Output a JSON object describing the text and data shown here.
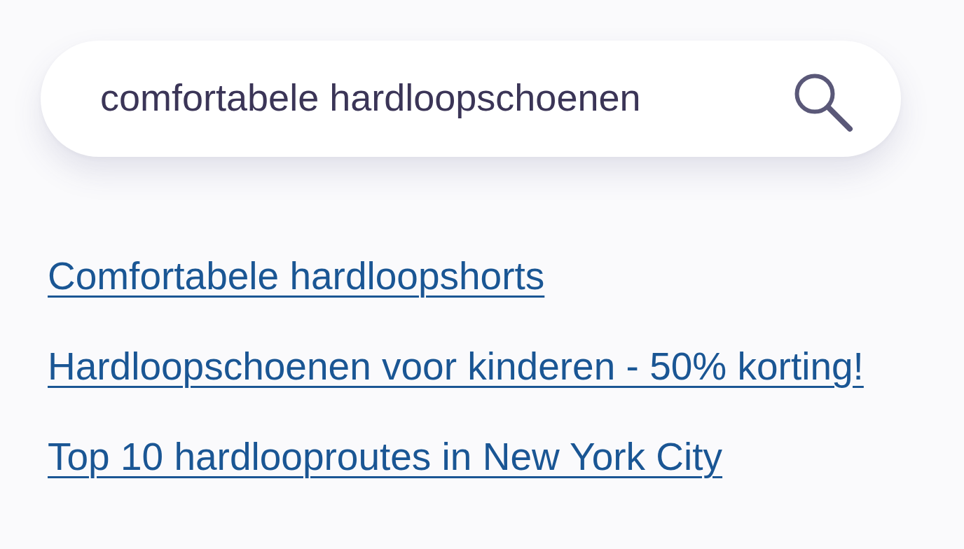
{
  "search": {
    "value": "comfortabele hardloopschoenen"
  },
  "suggestions": [
    {
      "text": "Comfortabele hardloopshorts"
    },
    {
      "text": "Hardloopschoenen voor kinderen - 50% korting!"
    },
    {
      "text": "Top 10 hardlooproutes in New York City"
    }
  ]
}
